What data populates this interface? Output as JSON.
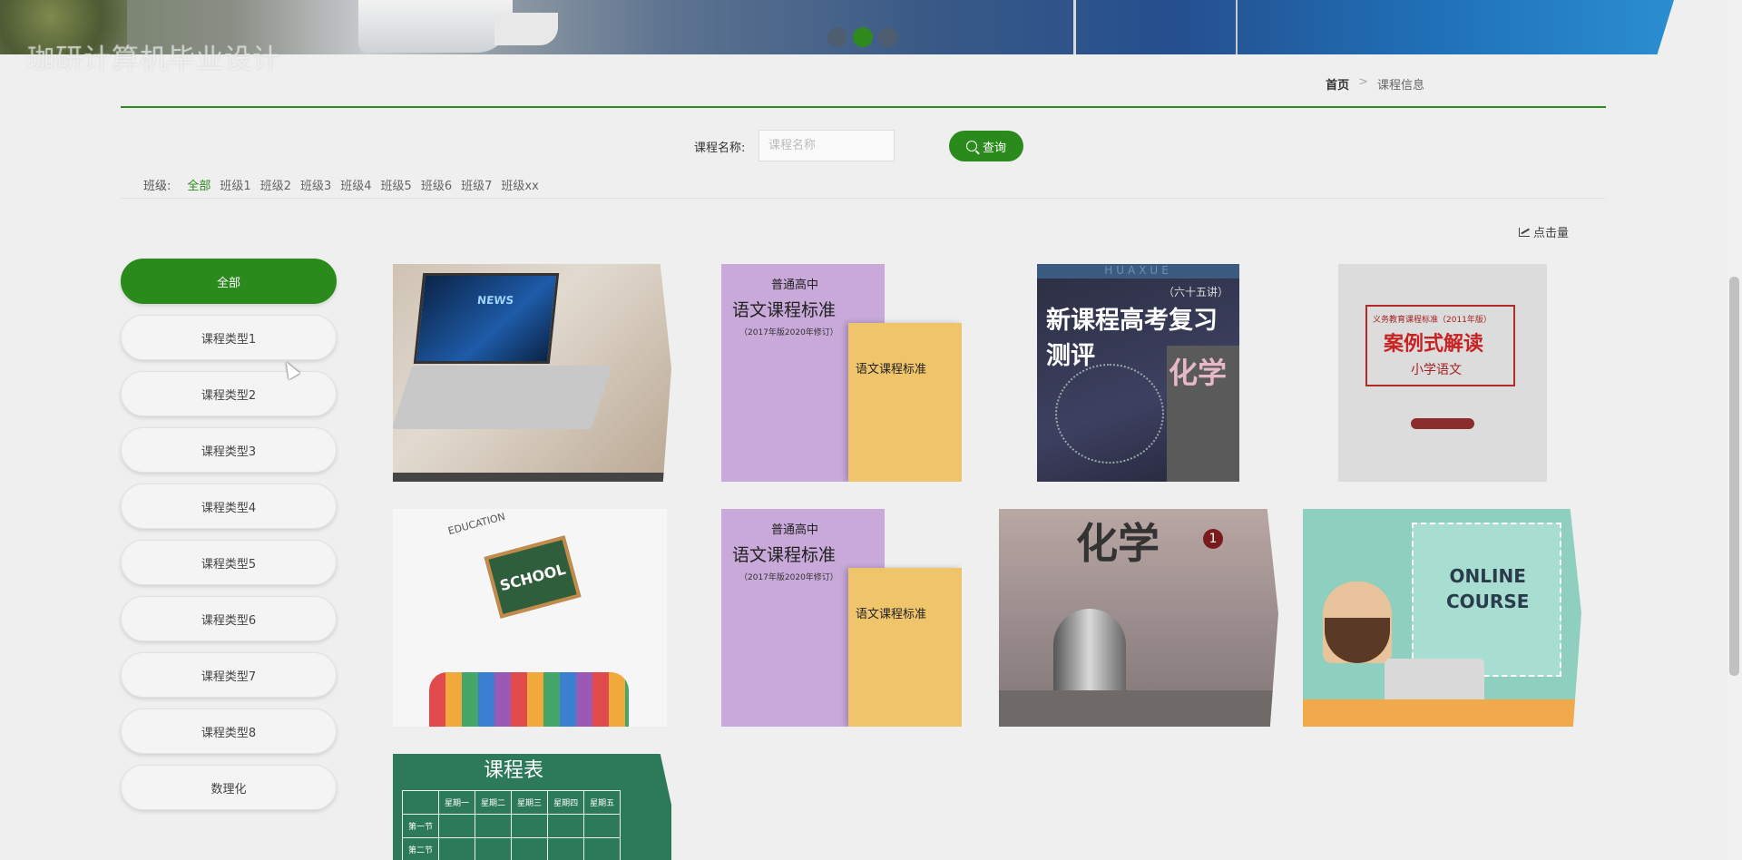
{
  "watermark": "珈研计算机毕业设计",
  "banner": {
    "dots": 3,
    "active_dot": 1
  },
  "breadcrumb": {
    "home": "首页",
    "separator": ">",
    "current": "课程信息"
  },
  "search": {
    "label": "课程名称:",
    "placeholder": "课程名称",
    "value": "",
    "button": "查询"
  },
  "class_filter": {
    "label": "班级:",
    "options": [
      "全部",
      "班级1",
      "班级2",
      "班级3",
      "班级4",
      "班级5",
      "班级6",
      "班级7",
      "班级xx"
    ],
    "active": "全部"
  },
  "sort": {
    "hits_label": "点击量"
  },
  "sidebar": {
    "items": [
      "全部",
      "课程类型1",
      "课程类型2",
      "课程类型3",
      "课程类型4",
      "课程类型5",
      "课程类型6",
      "课程类型7",
      "课程类型8",
      "数理化"
    ],
    "active": "全部"
  },
  "cards": {
    "laptop": {
      "screen_text": "NEWS"
    },
    "book1": {
      "t1": "普通高中",
      "t2": "语文课程标准",
      "t3": "（2017年版2020年修订）",
      "t4": "语文课程标准"
    },
    "chem": {
      "top": "HUAXUE",
      "h0": "（六十五讲）",
      "h1": "新课程高考复习测评",
      "h2": "化学"
    },
    "case": {
      "t1": "义务教育课程标准（2011年版）",
      "t2": "案例式解读",
      "t3": "小学语文"
    },
    "school": {
      "board": "SCHOOL",
      "lbl": "EDUCATION"
    },
    "book2": {
      "t1": "普通高中",
      "t2": "语文课程标准",
      "t3": "（2017年版2020年修订）",
      "t4": "语文课程标准"
    },
    "chem1": {
      "h1": "化学",
      "n1": "1"
    },
    "online": {
      "line1": "ONLINE",
      "line2": "COURSE"
    },
    "schedule": {
      "title": "课程表",
      "headers": [
        "",
        "星期一",
        "星期二",
        "星期三",
        "星期四",
        "星期五"
      ],
      "row1": "第一节",
      "row2": "第二节"
    }
  }
}
